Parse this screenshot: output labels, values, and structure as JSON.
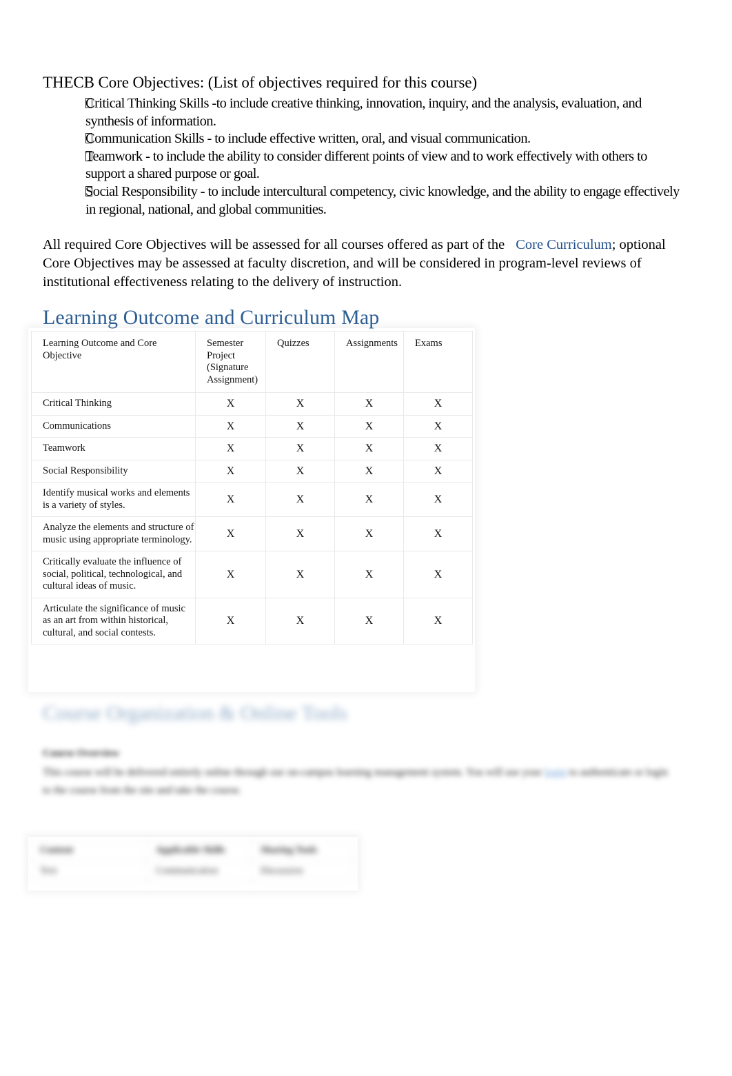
{
  "document": {
    "core_objectives_heading": "THECB Core Objectives: (List of objectives required for this course)",
    "objectives": [
      "Critical Thinking Skills -to include creative thinking, innovation, inquiry, and the analysis, evaluation, and synthesis of information.",
      "Communication Skills - to include effective written, oral, and visual communication.",
      "Teamwork -  to include the ability to consider different points of view and to work effectively with others to support a shared purpose or goal.",
      "Social Responsibility - to include intercultural competency, civic knowledge, and the ability to engage effectively in regional, national, and global communities."
    ],
    "assessment_paragraph": {
      "before_link": "All required Core Objectives will be assessed for all courses offered as part of the",
      "link_text": "Core Curriculum",
      "after_link": "; optional Core Objectives may be assessed at faculty discretion, and will be considered in program-level reviews of institutional effectiveness relating to the delivery of instruction."
    }
  },
  "curriculum_map": {
    "heading": "Learning Outcome and Curriculum Map",
    "columns": [
      "Learning Outcome and Core Objective",
      "Semester Project (Signature Assignment)",
      "Quizzes",
      "Assignments",
      "Exams"
    ],
    "rows": [
      {
        "outcome": "Critical Thinking",
        "semester_project": "X",
        "quizzes": "X",
        "assignments": "X",
        "exams": "X"
      },
      {
        "outcome": "Communications",
        "semester_project": "X",
        "quizzes": "X",
        "assignments": "X",
        "exams": "X"
      },
      {
        "outcome": "Teamwork",
        "semester_project": "X",
        "quizzes": "X",
        "assignments": "X",
        "exams": "X"
      },
      {
        "outcome": "Social Responsibility",
        "semester_project": "X",
        "quizzes": "X",
        "assignments": "X",
        "exams": "X"
      },
      {
        "outcome": "Identify musical works and elements is a variety of styles.",
        "semester_project": "X",
        "quizzes": "X",
        "assignments": "X",
        "exams": "X"
      },
      {
        "outcome": "Analyze the elements and structure of music using appropriate terminology.",
        "semester_project": "X",
        "quizzes": "X",
        "assignments": "X",
        "exams": "X"
      },
      {
        "outcome": "Critically evaluate the influence of social, political, technological, and cultural ideas of music.",
        "semester_project": "X",
        "quizzes": "X",
        "assignments": "X",
        "exams": "X"
      },
      {
        "outcome": "Articulate the significance of music as an art from within historical, cultural, and social contests.",
        "semester_project": "X",
        "quizzes": "X",
        "assignments": "X",
        "exams": "X"
      }
    ]
  },
  "lower_blurred_section": {
    "heading": "Course Organization & Online Tools",
    "subheading": "Course Overview",
    "paragraph_before_link": "This course will be delivered entirely online through our on-campus learning management system. You will use your",
    "paragraph_link": "login",
    "paragraph_after_link": "to authenticate or login to the course from the site and take the course.",
    "table_headers": [
      "Content",
      "Applicable Skills",
      "Sharing Tools"
    ],
    "table_row": [
      "Text",
      "Communication",
      "Discussion"
    ]
  },
  "colors": {
    "heading_blue": "#2e5f94",
    "link_blue": "#1f4e87",
    "table_border": "#e9e9ec",
    "text_black": "#000000"
  }
}
